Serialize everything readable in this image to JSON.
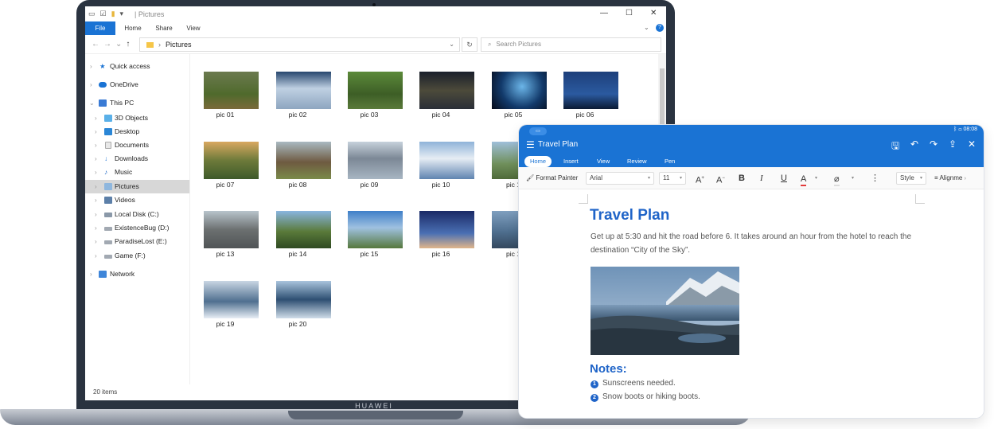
{
  "explorer": {
    "window_title": "Pictures",
    "ribbon_tabs": [
      "File",
      "Home",
      "Share",
      "View"
    ],
    "address": "Pictures",
    "search_placeholder": "Search Pictures",
    "sidebar": [
      {
        "label": "Quick access",
        "icon": "star-icon"
      },
      {
        "label": "OneDrive",
        "icon": "cloud-icon"
      },
      {
        "label": "This PC",
        "icon": "computer-icon"
      },
      {
        "label": "3D Objects",
        "icon": "cube-icon"
      },
      {
        "label": "Desktop",
        "icon": "desktop-icon"
      },
      {
        "label": "Documents",
        "icon": "document-icon"
      },
      {
        "label": "Downloads",
        "icon": "download-icon"
      },
      {
        "label": "Music",
        "icon": "music-icon"
      },
      {
        "label": "Pictures",
        "icon": "pictures-icon",
        "selected": true
      },
      {
        "label": "Videos",
        "icon": "video-icon"
      },
      {
        "label": "Local Disk (C:)",
        "icon": "drive-icon"
      },
      {
        "label": "ExistenceBug (D:)",
        "icon": "drive-icon"
      },
      {
        "label": "ParadiseLost (E:)",
        "icon": "drive-icon"
      },
      {
        "label": "Game (F:)",
        "icon": "drive-icon"
      },
      {
        "label": "Network",
        "icon": "network-icon"
      }
    ],
    "files": [
      "pic 01",
      "pic 02",
      "pic 03",
      "pic 04",
      "pic 05",
      "pic 06",
      "pic 07",
      "pic 08",
      "pic 09",
      "pic 10",
      "pic 1",
      "pic 13",
      "pic 14",
      "pic 15",
      "pic 16",
      "pic 1",
      "pic 19",
      "pic 20"
    ],
    "status": "20 items"
  },
  "laptop": {
    "brand": "HUAWEI"
  },
  "tablet": {
    "status_time": "08:08",
    "doc_title": "Travel Plan",
    "tabs": [
      "Home",
      "Insert",
      "View",
      "Review",
      "Pen"
    ],
    "toolbar": {
      "format_painter": "Format Painter",
      "font": "Arial",
      "size": "11",
      "style": "Style",
      "align": "Alignme"
    },
    "document": {
      "heading": "Travel Plan",
      "paragraph": "Get up at 5:30 and hit the road before 6. It takes around an hour from the hotel to reach the destination “City of the Sky”.",
      "notes_heading": "Notes:",
      "notes": [
        {
          "num": "1",
          "text": "Sunscreens needed."
        },
        {
          "num": "2",
          "text": "Snow boots or hiking boots."
        }
      ]
    }
  },
  "colors": {
    "accent": "#1a73d4",
    "heading": "#1f64c8",
    "selected": "#d7d7d7"
  }
}
